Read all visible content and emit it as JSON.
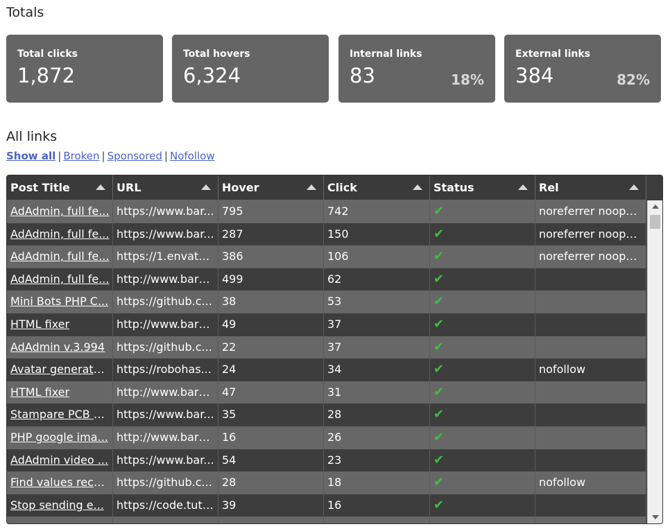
{
  "totals": {
    "title": "Totals",
    "cards": [
      {
        "label": "Total clicks",
        "value": "1,872",
        "pct": ""
      },
      {
        "label": "Total hovers",
        "value": "6,324",
        "pct": ""
      },
      {
        "label": "Internal links",
        "value": "83",
        "pct": "18%"
      },
      {
        "label": "External links",
        "value": "384",
        "pct": "82%"
      }
    ]
  },
  "links": {
    "title": "All links",
    "filters": [
      {
        "label": "Show all",
        "active": true
      },
      {
        "label": "Broken",
        "active": false
      },
      {
        "label": "Sponsored",
        "active": false
      },
      {
        "label": "Nofollow",
        "active": false
      }
    ],
    "separator": "|"
  },
  "table": {
    "columns": [
      "Post Title",
      "URL",
      "Hover",
      "Click",
      "Status",
      "Rel"
    ],
    "status_icon": "checkmark-icon",
    "status_glyph": "✔",
    "status_color": "#3cc23c",
    "rows": [
      {
        "title": "AdAdmin, full fe...",
        "url": "https://www.bar...",
        "hover": "795",
        "click": "742",
        "rel": "noreferrer noope..."
      },
      {
        "title": "AdAdmin, full fe...",
        "url": "https://www.bar...",
        "hover": "287",
        "click": "150",
        "rel": "noreferrer noope..."
      },
      {
        "title": "AdAdmin, full fe...",
        "url": "https://1.envato....",
        "hover": "386",
        "click": "106",
        "rel": "noreferrer noope..."
      },
      {
        "title": "AdAdmin, full fe...",
        "url": "http://www.bara...",
        "hover": "499",
        "click": "62",
        "rel": ""
      },
      {
        "title": "Mini Bots PHP C...",
        "url": "https://github.c...",
        "hover": "38",
        "click": "53",
        "rel": ""
      },
      {
        "title": "HTML fixer",
        "url": "http://www.bara...",
        "hover": "49",
        "click": "37",
        "rel": ""
      },
      {
        "title": "AdAdmin v.3.994",
        "url": "https://github.c...",
        "hover": "22",
        "click": "37",
        "rel": ""
      },
      {
        "title": "Avatar generato...",
        "url": "https://robohas...",
        "hover": "24",
        "click": "34",
        "rel": "nofollow"
      },
      {
        "title": "HTML fixer",
        "url": "http://www.bara...",
        "hover": "47",
        "click": "31",
        "rel": ""
      },
      {
        "title": "Stampare PCB p...",
        "url": "https://www.bar...",
        "hover": "35",
        "click": "28",
        "rel": ""
      },
      {
        "title": "PHP google ima...",
        "url": "http://www.bara...",
        "hover": "16",
        "click": "26",
        "rel": ""
      },
      {
        "title": "AdAdmin video ...",
        "url": "https://www.bar...",
        "hover": "54",
        "click": "23",
        "rel": ""
      },
      {
        "title": "Find values recu...",
        "url": "https://github.c...",
        "hover": "28",
        "click": "18",
        "rel": "nofollow"
      },
      {
        "title": "Stop sending e...",
        "url": "https://code.tuts...",
        "hover": "39",
        "click": "16",
        "rel": ""
      },
      {
        "title": "",
        "url": "",
        "hover": "",
        "click": "",
        "rel": ""
      }
    ]
  }
}
